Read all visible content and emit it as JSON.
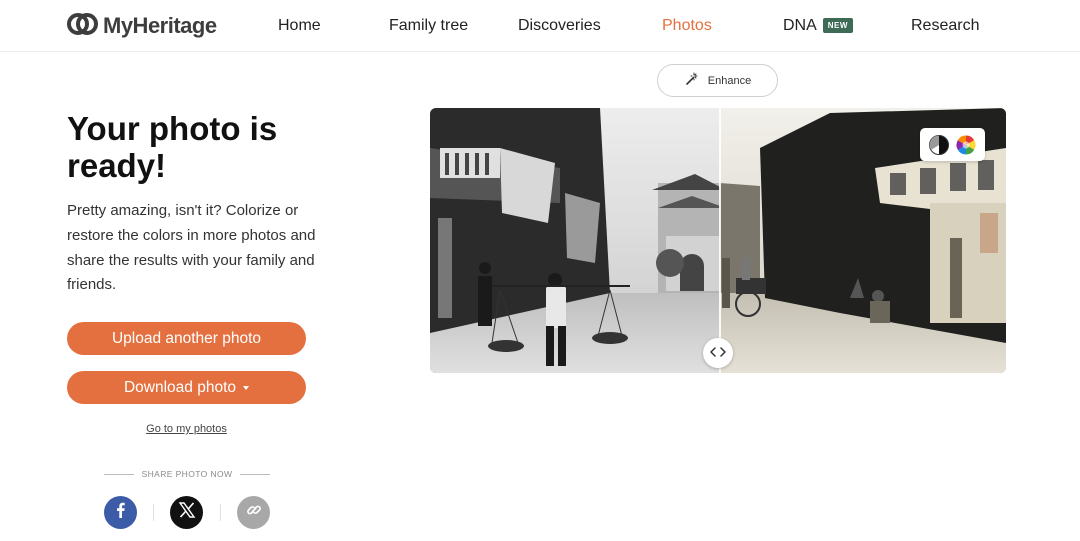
{
  "brand": {
    "name": "MyHeritage"
  },
  "nav": {
    "home": "Home",
    "family_tree": "Family tree",
    "discoveries": "Discoveries",
    "photos": "Photos",
    "dna": "DNA",
    "dna_badge": "NEW",
    "research": "Research"
  },
  "main": {
    "title": "Your photo is ready!",
    "description": "Pretty amazing, isn't it? Colorize or restore the colors in more photos and share the results with your family and friends.",
    "upload_label": "Upload another photo",
    "download_label": "Download photo",
    "go_link": "Go to my photos",
    "share_label": "SHARE PHOTO NOW"
  },
  "photo": {
    "enhance_label": "Enhance"
  },
  "colors": {
    "accent": "#e5703f",
    "active_nav": "#e5703f",
    "badge": "#3d6b56",
    "facebook": "#3d5ca8"
  },
  "icons": {
    "logo": "myheritage-logo-icon",
    "enhance": "magic-wand-icon",
    "bw_mode": "bw-contrast-icon",
    "color_mode": "color-wheel-icon",
    "slider": "left-right-arrows-icon",
    "facebook": "facebook-icon",
    "x": "x-twitter-icon",
    "link": "link-icon"
  }
}
